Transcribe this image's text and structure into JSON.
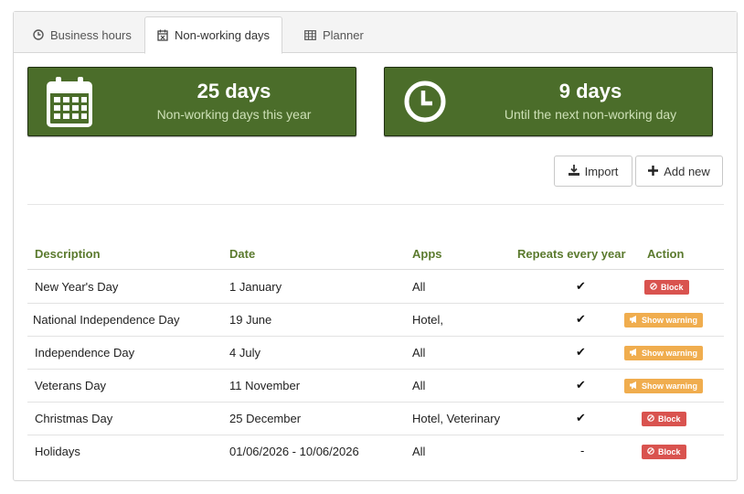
{
  "tabs": [
    {
      "label": "Business hours",
      "icon": "clock-icon"
    },
    {
      "label": "Non-working days",
      "icon": "calendar-x-icon",
      "active": true
    },
    {
      "label": "Planner",
      "icon": "table-icon"
    }
  ],
  "stats": [
    {
      "value": "25 days",
      "caption": "Non-working days this year",
      "icon": "calendar-icon"
    },
    {
      "value": "9 days",
      "caption": "Until the next non-working day",
      "icon": "clock-icon"
    }
  ],
  "actions": {
    "import_label": "Import",
    "add_label": "Add new"
  },
  "table": {
    "headers": [
      "Description",
      "Date",
      "Apps",
      "Repeats every year",
      "Action"
    ],
    "rows": [
      {
        "description": "New Year's Day",
        "date": "1 January",
        "apps": "All",
        "repeats": "✔",
        "action": "Block"
      },
      {
        "description": "National Independence Day",
        "date": "19 June",
        "apps": "Hotel,",
        "repeats": "✔",
        "action": "Show warning"
      },
      {
        "description": "Independence Day",
        "date": "4 July",
        "apps": "All",
        "repeats": "✔",
        "action": "Show warning"
      },
      {
        "description": "Veterans Day",
        "date": "11 November",
        "apps": "All",
        "repeats": "✔",
        "action": "Show warning"
      },
      {
        "description": "Christmas Day",
        "date": "25 December",
        "apps": "Hotel, Veterinary",
        "repeats": "✔",
        "action": "Block"
      },
      {
        "description": "Holidays",
        "date": "01/06/2026 - 10/06/2026",
        "apps": "All",
        "repeats": "-",
        "action": "Block"
      }
    ]
  },
  "colors": {
    "accent": "#4b6d2a",
    "header_text": "#5b7a2e",
    "block": "#d9534f",
    "warning": "#f0ad4e"
  }
}
